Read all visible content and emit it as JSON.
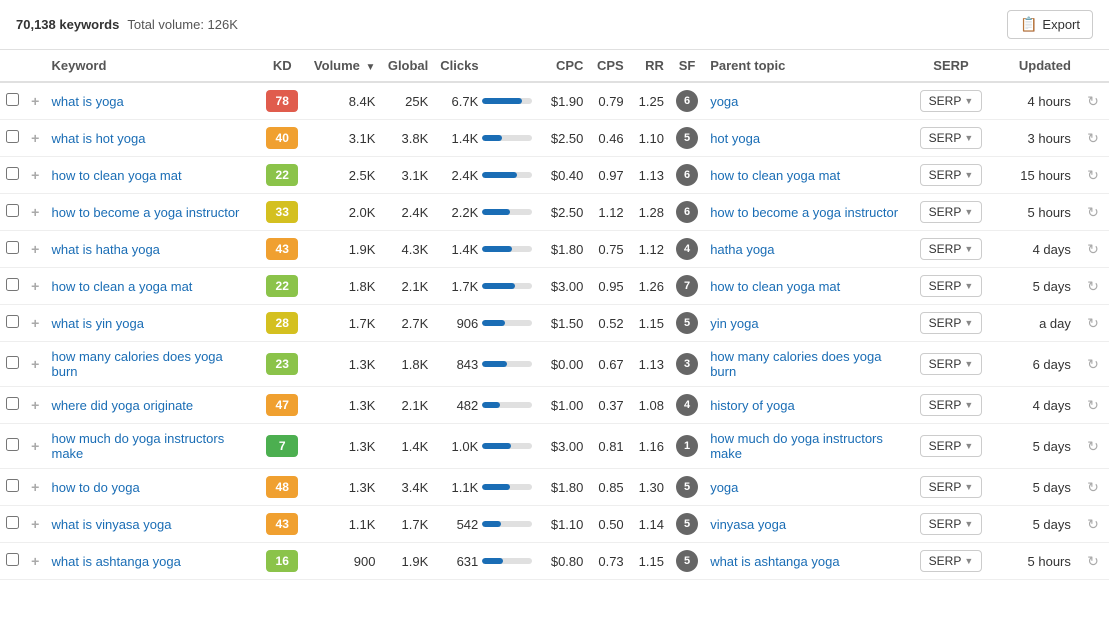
{
  "header": {
    "keyword_count": "70,138 keywords",
    "total_volume": "Total volume: 126K",
    "export_label": "Export"
  },
  "columns": {
    "keyword": "Keyword",
    "kd": "KD",
    "volume": "Volume",
    "global": "Global",
    "clicks": "Clicks",
    "cpc": "CPC",
    "cps": "CPS",
    "rr": "RR",
    "sf": "SF",
    "parent_topic": "Parent topic",
    "serp": "SERP",
    "updated": "Updated"
  },
  "rows": [
    {
      "keyword": "what is yoga",
      "kd": 78,
      "kd_class": "kd-red",
      "volume": "8.4K",
      "global": "25K",
      "clicks_value": "6.7K",
      "clicks_pct": 80,
      "cpc": "$1.90",
      "cps": "0.79",
      "rr": "1.25",
      "sf": 6,
      "parent_topic": "yoga",
      "updated": "4 hours"
    },
    {
      "keyword": "what is hot yoga",
      "kd": 40,
      "kd_class": "kd-orange",
      "volume": "3.1K",
      "global": "3.8K",
      "clicks_value": "1.4K",
      "clicks_pct": 40,
      "cpc": "$2.50",
      "cps": "0.46",
      "rr": "1.10",
      "sf": 5,
      "parent_topic": "hot yoga",
      "updated": "3 hours"
    },
    {
      "keyword": "how to clean yoga mat",
      "kd": 22,
      "kd_class": "kd-light-green",
      "volume": "2.5K",
      "global": "3.1K",
      "clicks_value": "2.4K",
      "clicks_pct": 70,
      "cpc": "$0.40",
      "cps": "0.97",
      "rr": "1.13",
      "sf": 6,
      "parent_topic": "how to clean yoga mat",
      "updated": "15 hours"
    },
    {
      "keyword": "how to become a yoga instructor",
      "kd": 33,
      "kd_class": "kd-yellow",
      "volume": "2.0K",
      "global": "2.4K",
      "clicks_value": "2.2K",
      "clicks_pct": 55,
      "cpc": "$2.50",
      "cps": "1.12",
      "rr": "1.28",
      "sf": 6,
      "parent_topic": "how to become a yoga instructor",
      "updated": "5 hours"
    },
    {
      "keyword": "what is hatha yoga",
      "kd": 43,
      "kd_class": "kd-orange",
      "volume": "1.9K",
      "global": "4.3K",
      "clicks_value": "1.4K",
      "clicks_pct": 60,
      "cpc": "$1.80",
      "cps": "0.75",
      "rr": "1.12",
      "sf": 4,
      "parent_topic": "hatha yoga",
      "updated": "4 days"
    },
    {
      "keyword": "how to clean a yoga mat",
      "kd": 22,
      "kd_class": "kd-light-green",
      "volume": "1.8K",
      "global": "2.1K",
      "clicks_value": "1.7K",
      "clicks_pct": 65,
      "cpc": "$3.00",
      "cps": "0.95",
      "rr": "1.26",
      "sf": 7,
      "parent_topic": "how to clean yoga mat",
      "updated": "5 days"
    },
    {
      "keyword": "what is yin yoga",
      "kd": 28,
      "kd_class": "kd-yellow",
      "volume": "1.7K",
      "global": "2.7K",
      "clicks_value": "906",
      "clicks_pct": 45,
      "cpc": "$1.50",
      "cps": "0.52",
      "rr": "1.15",
      "sf": 5,
      "parent_topic": "yin yoga",
      "updated": "a day"
    },
    {
      "keyword": "how many calories does yoga burn",
      "kd": 23,
      "kd_class": "kd-light-green",
      "volume": "1.3K",
      "global": "1.8K",
      "clicks_value": "843",
      "clicks_pct": 50,
      "cpc": "$0.00",
      "cps": "0.67",
      "rr": "1.13",
      "sf": 3,
      "parent_topic": "how many calories does yoga burn",
      "updated": "6 days"
    },
    {
      "keyword": "where did yoga originate",
      "kd": 47,
      "kd_class": "kd-orange",
      "volume": "1.3K",
      "global": "2.1K",
      "clicks_value": "482",
      "clicks_pct": 35,
      "cpc": "$1.00",
      "cps": "0.37",
      "rr": "1.08",
      "sf": 4,
      "parent_topic": "history of yoga",
      "updated": "4 days"
    },
    {
      "keyword": "how much do yoga instructors make",
      "kd": 7,
      "kd_class": "kd-green",
      "volume": "1.3K",
      "global": "1.4K",
      "clicks_value": "1.0K",
      "clicks_pct": 58,
      "cpc": "$3.00",
      "cps": "0.81",
      "rr": "1.16",
      "sf": 1,
      "parent_topic": "how much do yoga instructors make",
      "updated": "5 days"
    },
    {
      "keyword": "how to do yoga",
      "kd": 48,
      "kd_class": "kd-orange",
      "volume": "1.3K",
      "global": "3.4K",
      "clicks_value": "1.1K",
      "clicks_pct": 55,
      "cpc": "$1.80",
      "cps": "0.85",
      "rr": "1.30",
      "sf": 5,
      "parent_topic": "yoga",
      "updated": "5 days"
    },
    {
      "keyword": "what is vinyasa yoga",
      "kd": 43,
      "kd_class": "kd-orange",
      "volume": "1.1K",
      "global": "1.7K",
      "clicks_value": "542",
      "clicks_pct": 38,
      "cpc": "$1.10",
      "cps": "0.50",
      "rr": "1.14",
      "sf": 5,
      "parent_topic": "vinyasa yoga",
      "updated": "5 days"
    },
    {
      "keyword": "what is ashtanga yoga",
      "kd": 16,
      "kd_class": "kd-light-green",
      "volume": "900",
      "global": "1.9K",
      "clicks_value": "631",
      "clicks_pct": 42,
      "cpc": "$0.80",
      "cps": "0.73",
      "rr": "1.15",
      "sf": 5,
      "parent_topic": "what is ashtanga yoga",
      "updated": "5 hours"
    }
  ]
}
